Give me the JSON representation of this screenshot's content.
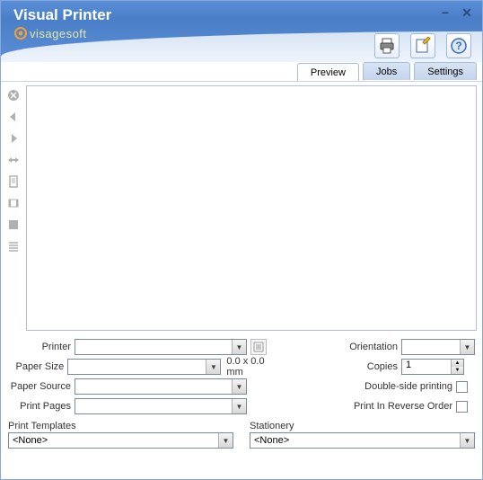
{
  "title": "Visual Printer",
  "brand": "visagesoft",
  "tabs": {
    "preview": "Preview",
    "jobs": "Jobs",
    "settings": "Settings"
  },
  "fields": {
    "printer_label": "Printer",
    "paper_size_label": "Paper Size",
    "paper_source_label": "Paper Source",
    "print_pages_label": "Print Pages",
    "orientation_label": "Orientation",
    "copies_label": "Copies",
    "copies_value": "1",
    "dimensions": "0.0 x 0.0 mm",
    "double_side_label": "Double-side printing",
    "reverse_label": "Print In Reverse Order"
  },
  "templates": {
    "print_templates_label": "Print Templates",
    "print_templates_value": "<None>",
    "stationery_label": "Stationery",
    "stationery_value": "<None>"
  }
}
